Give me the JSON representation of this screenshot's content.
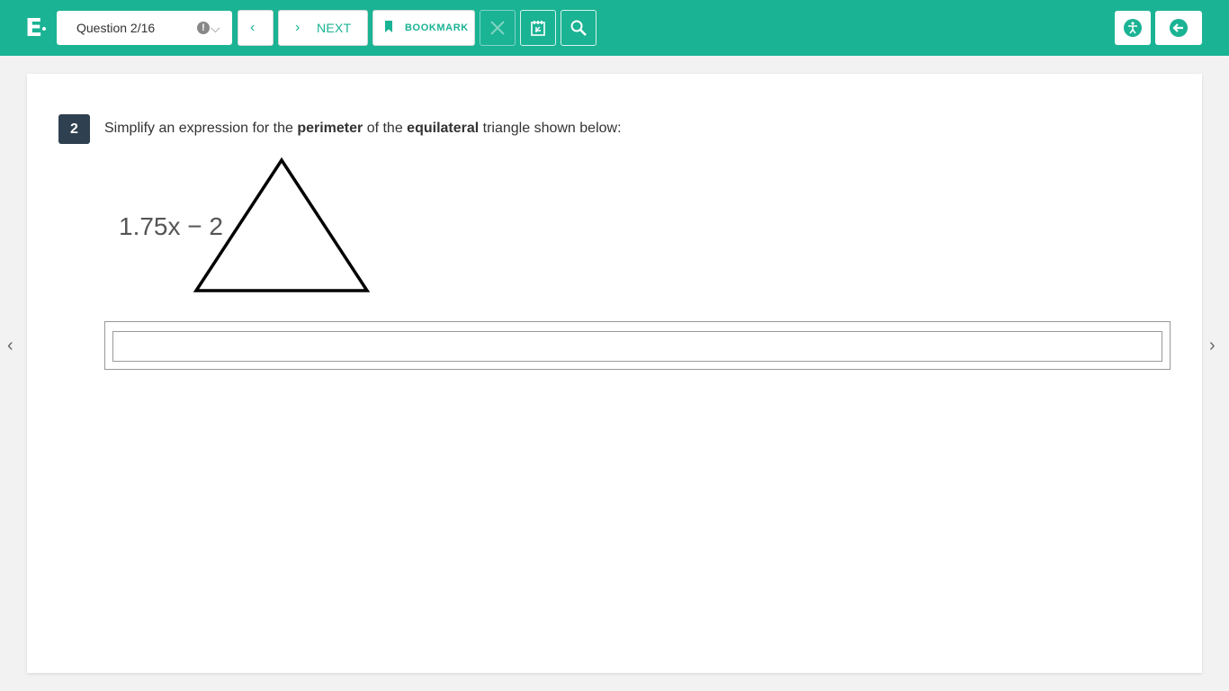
{
  "header": {
    "logo_letter": "E",
    "question_selector": {
      "label": "Question 2/16",
      "alert_glyph": "!",
      "chevron_glyph": "⌵"
    },
    "prev_icon": "‹",
    "next": {
      "icon": "›",
      "label": "NEXT"
    },
    "bookmark": {
      "label": "BOOKMARK",
      "icon": "bookmark-icon"
    },
    "tools": [
      "close-icon",
      "calendar-icon",
      "search-icon"
    ],
    "right_buttons": [
      "accessibility-icon",
      "exit-icon"
    ],
    "colors": {
      "bar": "#1ab394",
      "badge": "#2f4050"
    }
  },
  "nav": {
    "left_arrow": "‹",
    "right_arrow": "›"
  },
  "question": {
    "number": "2",
    "prompt_before": "Simplify an expression for the ",
    "bold_1": "perimeter",
    "prompt_middle": " of the ",
    "bold_2": "equilateral",
    "prompt_after": " triangle shown below:",
    "figure_label": "1.75x − 2",
    "answer_value": "",
    "answer_placeholder": ""
  }
}
